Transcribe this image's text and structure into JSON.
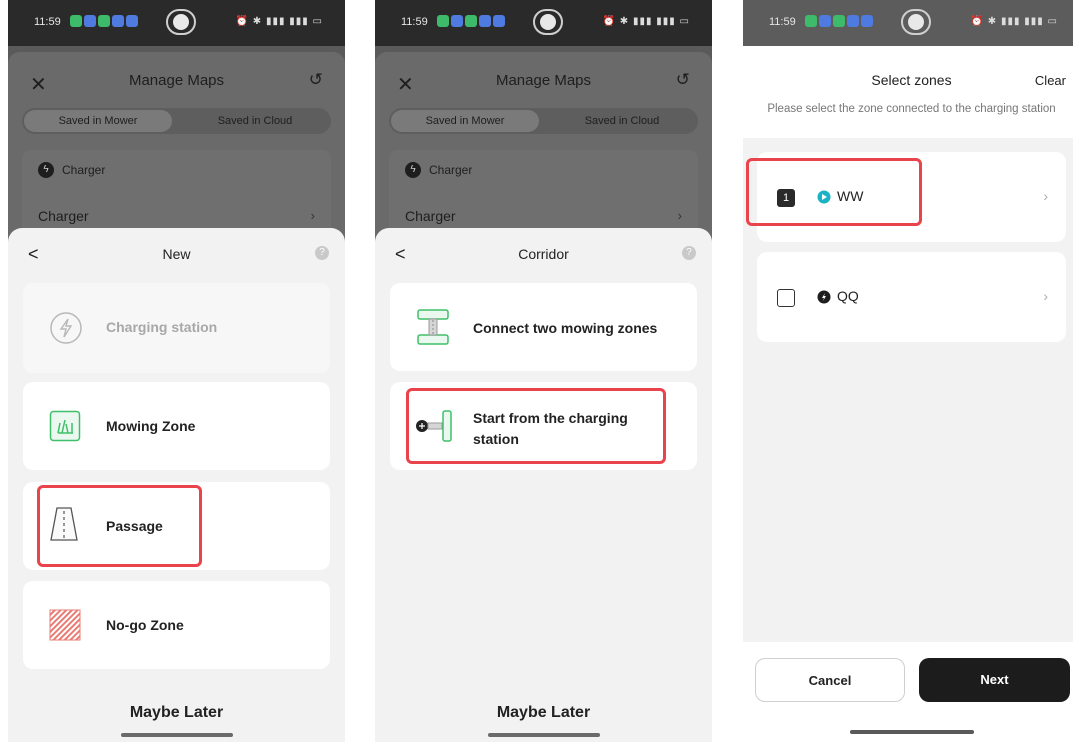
{
  "status": {
    "time": "11:59"
  },
  "manage": {
    "title": "Manage Maps",
    "seg_mower": "Saved in Mower",
    "seg_cloud": "Saved in Cloud",
    "charger_section": "Charger",
    "charger_item": "Charger",
    "chevron": "›"
  },
  "panel1": {
    "title": "New",
    "items": [
      "Charging station",
      "Mowing Zone",
      "Passage",
      "No-go Zone"
    ],
    "maybe_later": "Maybe Later"
  },
  "panel2": {
    "title": "Corridor",
    "items": [
      "Connect two mowing zones",
      "Start from the charging station"
    ],
    "maybe_later": "Maybe Later"
  },
  "panel3": {
    "title": "Select zones",
    "clear": "Clear",
    "subtitle": "Please select the zone connected to the charging station",
    "zones": [
      {
        "index": "1",
        "name": "WW",
        "selected": true,
        "color": "#19b3c4"
      },
      {
        "index": "",
        "name": "QQ",
        "selected": false,
        "color": "#1e1e1e"
      }
    ],
    "cancel": "Cancel",
    "next": "Next"
  },
  "colors": {
    "highlight": "#e9434c",
    "mowing_green": "#3fbf6a",
    "nogo_red": "#e87c74"
  }
}
